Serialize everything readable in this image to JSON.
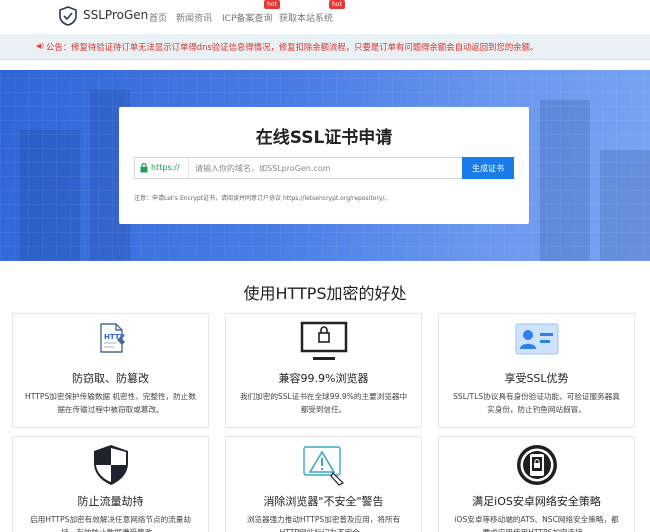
{
  "nav": {
    "brand": "SSLProGen",
    "items": [
      "首页",
      "新闻资讯",
      "ICP备案查询",
      "获取本站系统"
    ],
    "hot_badge": "hot"
  },
  "notice": {
    "icon": "megaphone-icon",
    "text": "公告：修复待验证待订单无法显示订单得dns验证信息得情况，修复扣除余额流程，只要是订单有问题得余额会自动返回到您的余额。"
  },
  "hero": {
    "title": "在线SSL证书申请",
    "protocol": "https://",
    "placeholder": "请输入你的域名，如SSLproGen.com",
    "button": "生成证书",
    "note": "注意：申请Let's Encrypt证书，请阅读并同意订户协议 https://letsencrypt.org/repository/。"
  },
  "benefits": {
    "title": "使用HTTPS加密的好处",
    "features": [
      {
        "icon": "http-document-icon",
        "title": "防窃取、防篡改",
        "desc": "HTTPS加密保护传输数据 机密性、完整性，防止数据在传输过程中被窃取或篡改。"
      },
      {
        "icon": "browser-lock-icon",
        "title": "兼容99.9%浏览器",
        "desc": "我们加密的SSL证书在全球99.9%的主要浏览器中都受到信任。"
      },
      {
        "icon": "id-card-icon",
        "title": "享受SSL优势",
        "desc": "SSL/TLS协议具有身份验证功能，可验证服务器真实身份，防止钓鱼网站假冒。"
      },
      {
        "icon": "shield-icon",
        "title": "防止流量劫持",
        "desc": "启用HTTPS加密有效解决任意网络节点的流量劫持，有效防止数据遭受篡改。"
      },
      {
        "icon": "warning-icon",
        "title": "消除浏览器\"不安全\"警告",
        "desc": "浏览器强力推动HTTPS加密普及应用，将所有HTTP网站标记为不安全。"
      },
      {
        "icon": "mobile-lock-icon",
        "title": "满足iOS安卓网络安全策略",
        "desc": "iOS安卓等移动端的ATS、NSC网络安全策略，都要求应用使用HTTPS加密连接。"
      }
    ]
  },
  "colors": {
    "accent": "#1b7be8",
    "notice_text": "#d9322c",
    "hot": "#e53935",
    "https_green": "#1aa04f"
  }
}
